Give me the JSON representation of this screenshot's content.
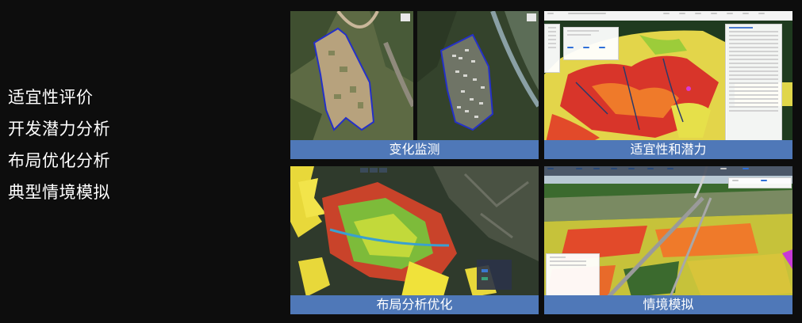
{
  "features": [
    {
      "label": "适宜性评价"
    },
    {
      "label": "开发潜力分析"
    },
    {
      "label": "布局优化分析"
    },
    {
      "label": "典型情境模拟"
    }
  ],
  "panels": {
    "change_monitoring": {
      "caption": "变化监测"
    },
    "suitability_potential": {
      "caption": "适宜性和潜力"
    },
    "layout_optimization": {
      "caption": "布局分析优化"
    },
    "scenario_simulation": {
      "caption": "情境模拟"
    }
  },
  "colors": {
    "caption_bar": "#4f78b8",
    "background": "#0d0d0d"
  }
}
